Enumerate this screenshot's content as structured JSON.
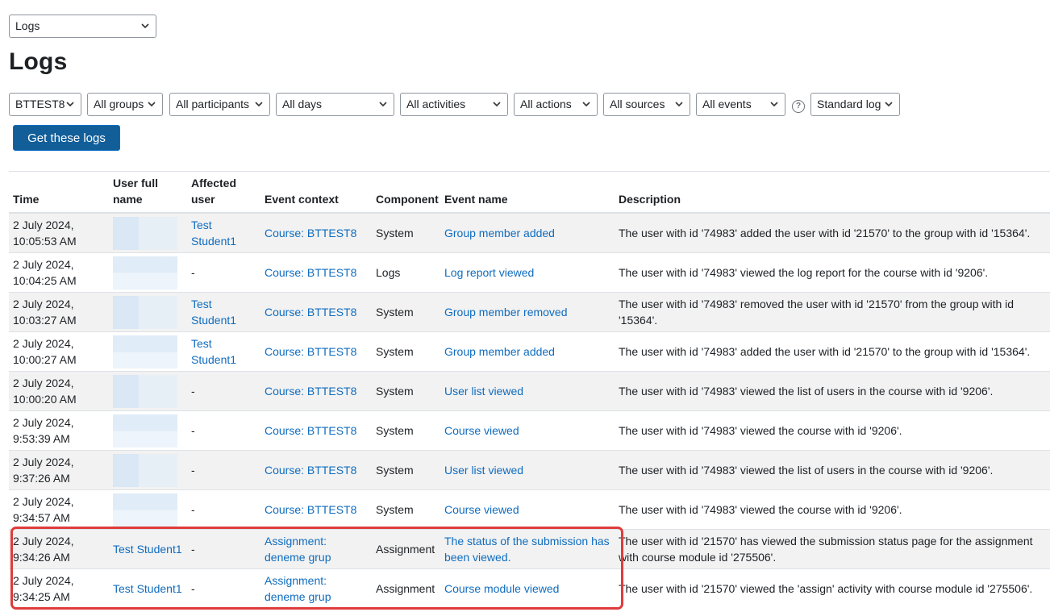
{
  "report_select": {
    "value": "Logs"
  },
  "page_title": "Logs",
  "filters": [
    {
      "name": "course-filter",
      "value": "BTTEST8"
    },
    {
      "name": "group-filter",
      "value": "All groups"
    },
    {
      "name": "participant-filter",
      "value": "All participants"
    },
    {
      "name": "day-filter",
      "value": "All days"
    },
    {
      "name": "activity-filter",
      "value": "All activities"
    },
    {
      "name": "action-filter",
      "value": "All actions"
    },
    {
      "name": "source-filter",
      "value": "All sources"
    },
    {
      "name": "event-filter",
      "value": "All events"
    },
    {
      "name": "logstore-filter",
      "value": "Standard log"
    }
  ],
  "help_icon": "?",
  "get_logs_button": "Get these logs",
  "table": {
    "headers": {
      "time": "Time",
      "user_full_name": "User full name",
      "affected_user": "Affected user",
      "event_context": "Event context",
      "component": "Component",
      "event_name": "Event name",
      "description": "Description"
    },
    "rows": [
      {
        "time": "2 July 2024, 10:05:53 AM",
        "user": "",
        "affected": "Test Student1",
        "context": "Course: BTTEST8",
        "component": "System",
        "event": "Group member added",
        "description": "The user with id '74983' added the user with id '21570' to the group with id '15364'."
      },
      {
        "time": "2 July 2024, 10:04:25 AM",
        "user": "",
        "affected": "-",
        "context": "Course: BTTEST8",
        "component": "Logs",
        "event": "Log report viewed",
        "description": "The user with id '74983' viewed the log report for the course with id '9206'."
      },
      {
        "time": "2 July 2024, 10:03:27 AM",
        "user": "",
        "affected": "Test Student1",
        "context": "Course: BTTEST8",
        "component": "System",
        "event": "Group member removed",
        "description": "The user with id '74983' removed the user with id '21570' from the group with id '15364'."
      },
      {
        "time": "2 July 2024, 10:00:27 AM",
        "user": "",
        "affected": "Test Student1",
        "context": "Course: BTTEST8",
        "component": "System",
        "event": "Group member added",
        "description": "The user with id '74983' added the user with id '21570' to the group with id '15364'."
      },
      {
        "time": "2 July 2024, 10:00:20 AM",
        "user": "",
        "affected": "-",
        "context": "Course: BTTEST8",
        "component": "System",
        "event": "User list viewed",
        "description": "The user with id '74983' viewed the list of users in the course with id '9206'."
      },
      {
        "time": "2 July 2024, 9:53:39 AM",
        "user": "",
        "affected": "-",
        "context": "Course: BTTEST8",
        "component": "System",
        "event": "Course viewed",
        "description": "The user with id '74983' viewed the course with id '9206'."
      },
      {
        "time": "2 July 2024, 9:37:26 AM",
        "user": "",
        "affected": "-",
        "context": "Course: BTTEST8",
        "component": "System",
        "event": "User list viewed",
        "description": "The user with id '74983' viewed the list of users in the course with id '9206'."
      },
      {
        "time": "2 July 2024, 9:34:57 AM",
        "user": "",
        "affected": "-",
        "context": "Course: BTTEST8",
        "component": "System",
        "event": "Course viewed",
        "description": "The user with id '74983' viewed the course with id '9206'."
      },
      {
        "time": "2 July 2024, 9:34:26 AM",
        "user": "Test Student1",
        "affected": "-",
        "context": "Assignment: deneme grup",
        "component": "Assignment",
        "event": "The status of the submission has been viewed.",
        "description": "The user with id '21570' has viewed the submission status page for the assignment with course module id '275506'."
      },
      {
        "time": "2 July 2024, 9:34:25 AM",
        "user": "Test Student1",
        "affected": "-",
        "context": "Assignment: deneme grup",
        "component": "Assignment",
        "event": "Course module viewed",
        "description": "The user with id '21570' viewed the 'assign' activity with course module id '275506'."
      }
    ]
  },
  "colors": {
    "link": "#0f6cbf",
    "button": "#115e99",
    "highlight": "#e03b3b",
    "stripe": "#f2f2f2"
  }
}
